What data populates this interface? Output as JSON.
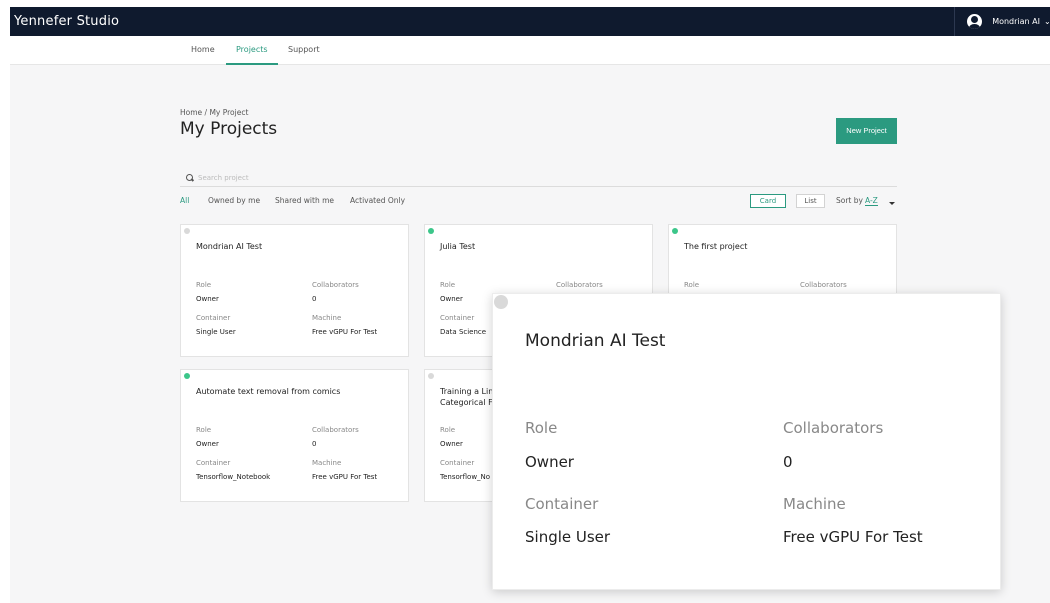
{
  "app": {
    "brand_light": "Yennefer",
    "brand_bold": "",
    "brand_suffix": "Studio"
  },
  "user": {
    "name": "Mondrian AI"
  },
  "nav": {
    "home": "Home",
    "projects": "Projects",
    "support": "Support"
  },
  "breadcrumb": "Home  /  My Project",
  "page_title": "My Projects",
  "new_project_label": "New Project",
  "search": {
    "placeholder": "Search project"
  },
  "filters": [
    "All",
    "Owned by me",
    "Shared with me",
    "Activated Only"
  ],
  "view": {
    "card": "Card",
    "list": "List",
    "sort_label": "Sort by",
    "sort_value": "A-Z"
  },
  "colors": {
    "accent": "#2b9a80",
    "status_active": "#3cc68a",
    "status_inactive": "#d9d9d9",
    "topbar": "#0f1a2e"
  },
  "labels": {
    "role": "Role",
    "collaborators": "Collaborators",
    "container": "Container",
    "machine": "Machine"
  },
  "cards": [
    {
      "title": "Mondrian AI Test",
      "status": "inactive",
      "role": "Owner",
      "collaborators": "0",
      "container": "Single User",
      "machine": "Free vGPU For Test"
    },
    {
      "title": "Julia Test",
      "status": "active",
      "role": "Owner",
      "collaborators": "",
      "container": "Data Science",
      "machine": ""
    },
    {
      "title": "The first project",
      "status": "active",
      "role": "",
      "collaborators": "",
      "container": "",
      "machine": ""
    },
    {
      "title": "Automate text removal from comics",
      "status": "active",
      "role": "Owner",
      "collaborators": "0",
      "container": "Tensorflow_Notebook",
      "machine": "Free vGPU For Test"
    },
    {
      "title_line1": "Training a Lin",
      "title_line2": "Categorical F",
      "status": "inactive",
      "role": "Owner",
      "collaborators": "",
      "container": "Tensorflow_No",
      "machine": ""
    }
  ],
  "zoom_card": {
    "title": "Mondrian AI Test",
    "role": "Owner",
    "collaborators": "0",
    "container": "Single User",
    "machine": "Free vGPU For Test"
  }
}
